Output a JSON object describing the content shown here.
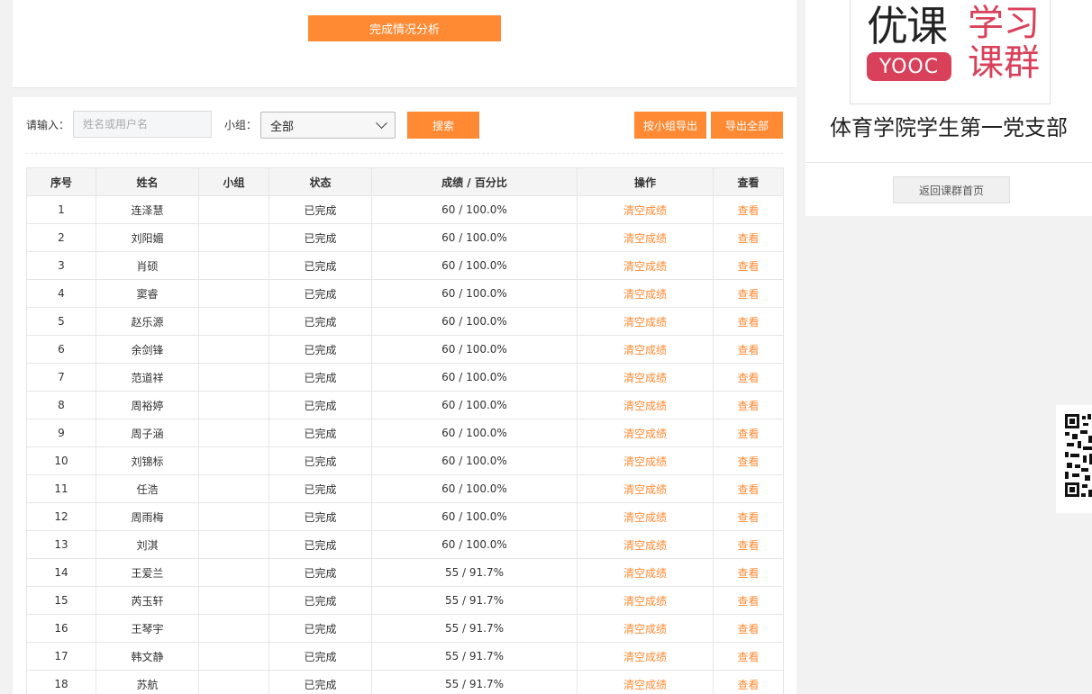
{
  "top": {
    "analysis_button": "完成情况分析"
  },
  "toolbar": {
    "input_label": "请输入：",
    "search_placeholder": "姓名或用户名",
    "group_label": "小组：",
    "group_selected": "全部",
    "search_button": "搜索",
    "export_group_button": "按小组导出",
    "export_all_button": "导出全部"
  },
  "table": {
    "headers": [
      "序号",
      "姓名",
      "小组",
      "状态",
      "成绩 / 百分比",
      "操作",
      "查看"
    ],
    "rows": [
      {
        "no": "1",
        "name": "连泽慧",
        "group": "",
        "status": "已完成",
        "score": "60 / 100.0%",
        "action": "清空成绩",
        "view": "查看"
      },
      {
        "no": "2",
        "name": "刘阳媚",
        "group": "",
        "status": "已完成",
        "score": "60 / 100.0%",
        "action": "清空成绩",
        "view": "查看"
      },
      {
        "no": "3",
        "name": "肖硕",
        "group": "",
        "status": "已完成",
        "score": "60 / 100.0%",
        "action": "清空成绩",
        "view": "查看"
      },
      {
        "no": "4",
        "name": "窦睿",
        "group": "",
        "status": "已完成",
        "score": "60 / 100.0%",
        "action": "清空成绩",
        "view": "查看"
      },
      {
        "no": "5",
        "name": "赵乐源",
        "group": "",
        "status": "已完成",
        "score": "60 / 100.0%",
        "action": "清空成绩",
        "view": "查看"
      },
      {
        "no": "6",
        "name": "余剑锋",
        "group": "",
        "status": "已完成",
        "score": "60 / 100.0%",
        "action": "清空成绩",
        "view": "查看"
      },
      {
        "no": "7",
        "name": "范道祥",
        "group": "",
        "status": "已完成",
        "score": "60 / 100.0%",
        "action": "清空成绩",
        "view": "查看"
      },
      {
        "no": "8",
        "name": "周裕婷",
        "group": "",
        "status": "已完成",
        "score": "60 / 100.0%",
        "action": "清空成绩",
        "view": "查看"
      },
      {
        "no": "9",
        "name": "周子涵",
        "group": "",
        "status": "已完成",
        "score": "60 / 100.0%",
        "action": "清空成绩",
        "view": "查看"
      },
      {
        "no": "10",
        "name": "刘锦标",
        "group": "",
        "status": "已完成",
        "score": "60 / 100.0%",
        "action": "清空成绩",
        "view": "查看"
      },
      {
        "no": "11",
        "name": "任浩",
        "group": "",
        "status": "已完成",
        "score": "60 / 100.0%",
        "action": "清空成绩",
        "view": "查看"
      },
      {
        "no": "12",
        "name": "周雨梅",
        "group": "",
        "status": "已完成",
        "score": "60 / 100.0%",
        "action": "清空成绩",
        "view": "查看"
      },
      {
        "no": "13",
        "name": "刘淇",
        "group": "",
        "status": "已完成",
        "score": "60 / 100.0%",
        "action": "清空成绩",
        "view": "查看"
      },
      {
        "no": "14",
        "name": "王爱兰",
        "group": "",
        "status": "已完成",
        "score": "55 / 91.7%",
        "action": "清空成绩",
        "view": "查看"
      },
      {
        "no": "15",
        "name": "芮玉轩",
        "group": "",
        "status": "已完成",
        "score": "55 / 91.7%",
        "action": "清空成绩",
        "view": "查看"
      },
      {
        "no": "16",
        "name": "王琴宇",
        "group": "",
        "status": "已完成",
        "score": "55 / 91.7%",
        "action": "清空成绩",
        "view": "查看"
      },
      {
        "no": "17",
        "name": "韩文静",
        "group": "",
        "status": "已完成",
        "score": "55 / 91.7%",
        "action": "清空成绩",
        "view": "查看"
      },
      {
        "no": "18",
        "name": "苏航",
        "group": "",
        "status": "已完成",
        "score": "55 / 91.7%",
        "action": "清空成绩",
        "view": "查看"
      }
    ]
  },
  "sidebar": {
    "logo": {
      "cn_left": "优课",
      "badge": "YOOC",
      "cn_right_top": "学习",
      "cn_right_bottom": "课群"
    },
    "group_name": "体育学院学生第一党支部",
    "back_button": "返回课群首页"
  },
  "colors": {
    "accent": "#ff8a33",
    "brand_red": "#d9415a",
    "background": "#f2f2f2"
  },
  "icons": {
    "qr": "qr-code-icon",
    "select": "chevron-down-icon"
  }
}
